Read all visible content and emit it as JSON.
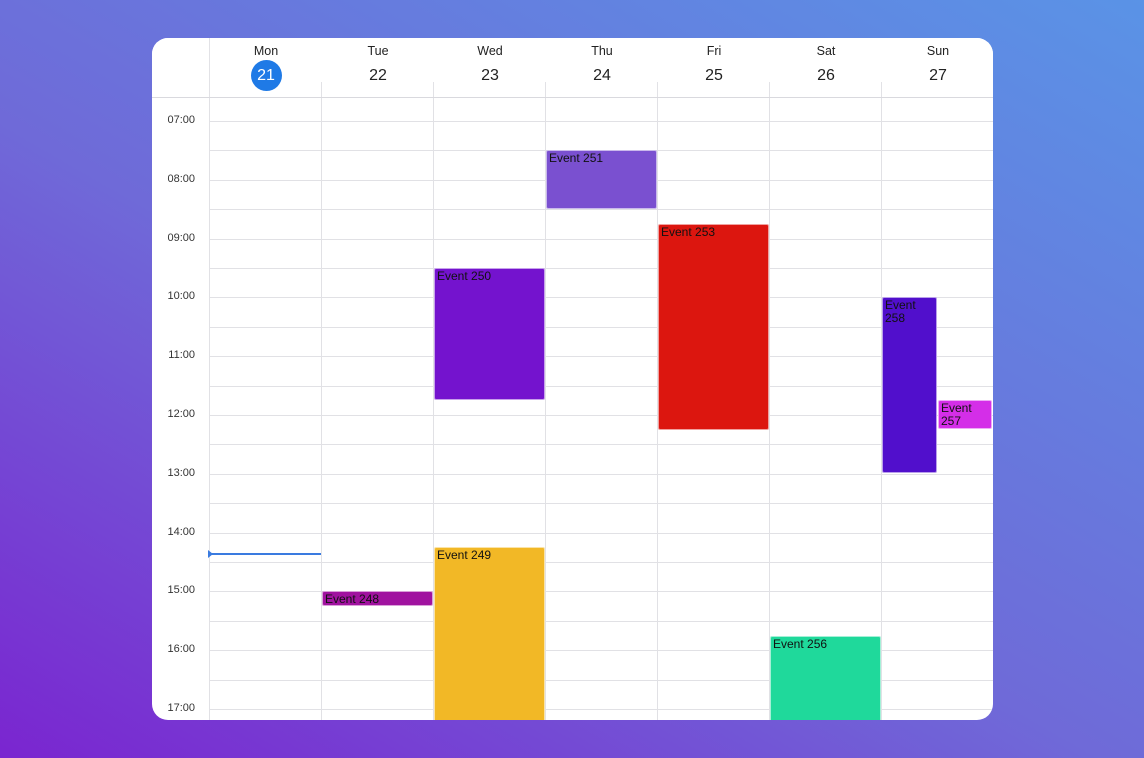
{
  "calendar": {
    "days": [
      {
        "name": "Mon",
        "date": "21",
        "today": true
      },
      {
        "name": "Tue",
        "date": "22",
        "today": false
      },
      {
        "name": "Wed",
        "date": "23",
        "today": false
      },
      {
        "name": "Thu",
        "date": "24",
        "today": false
      },
      {
        "name": "Fri",
        "date": "25",
        "today": false
      },
      {
        "name": "Sat",
        "date": "26",
        "today": false
      },
      {
        "name": "Sun",
        "date": "27",
        "today": false
      }
    ],
    "times": [
      "07:00",
      "08:00",
      "09:00",
      "10:00",
      "11:00",
      "12:00",
      "13:00",
      "14:00",
      "15:00",
      "16:00",
      "17:00"
    ],
    "current_time": "14:21",
    "events": [
      {
        "title": "Event 251",
        "day": 3,
        "start": "07:30",
        "end": "08:30",
        "color": "#7a50d0"
      },
      {
        "title": "Event 253",
        "day": 4,
        "start": "08:45",
        "end": "12:15",
        "color": "#dc160f"
      },
      {
        "title": "Event 250",
        "day": 2,
        "start": "09:30",
        "end": "11:45",
        "color": "#7413ce"
      },
      {
        "title": "Event 258",
        "day": 6,
        "start": "10:00",
        "end": "13:00",
        "color": "#510fcc"
      },
      {
        "title": "Event 257",
        "day": 6,
        "start": "11:45",
        "end": "12:15",
        "color": "#d42ee8"
      },
      {
        "title": "Event 249",
        "day": 2,
        "start": "14:15",
        "end": "17:30",
        "color": "#f2b826"
      },
      {
        "title": "Event 248",
        "day": 1,
        "start": "15:00",
        "end": "15:15",
        "color": "#a0129f"
      },
      {
        "title": "Event 256",
        "day": 5,
        "start": "15:45",
        "end": "17:30",
        "color": "#1fd99b"
      }
    ]
  }
}
